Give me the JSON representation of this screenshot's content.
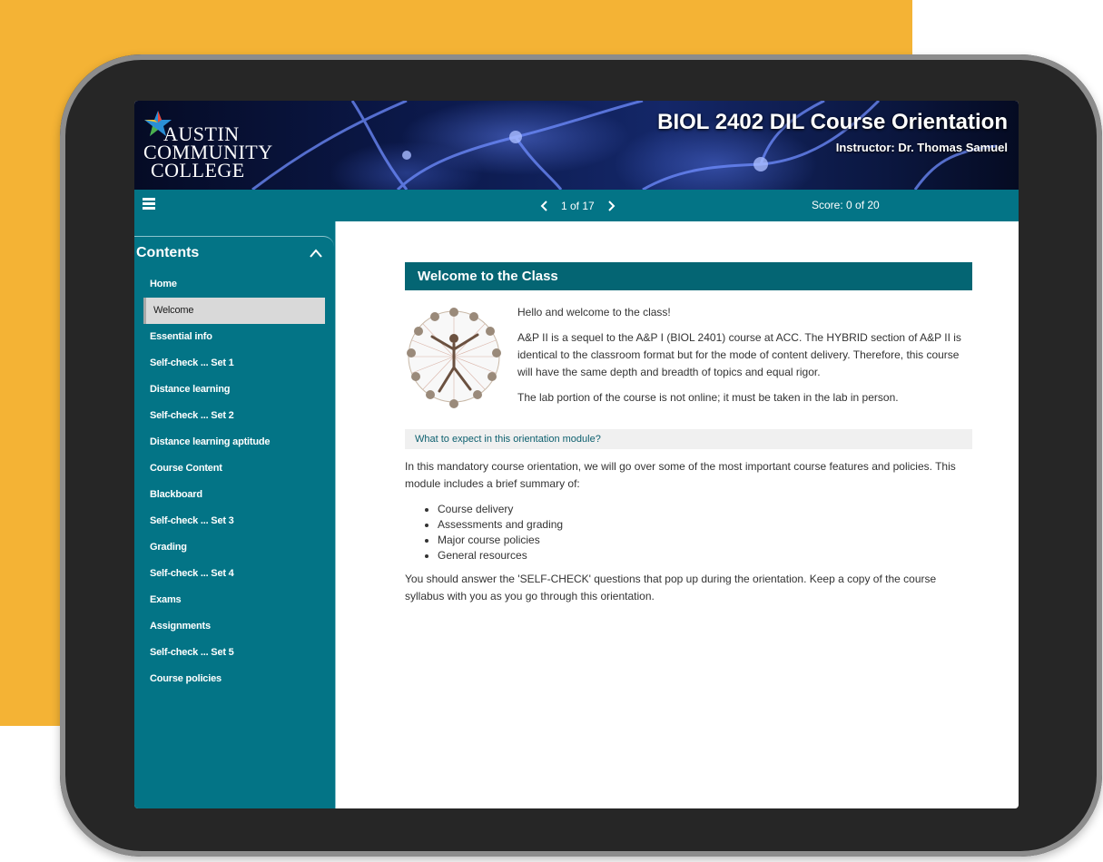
{
  "logo": {
    "line1": "Austin",
    "line2": "Community",
    "line3": "College"
  },
  "header": {
    "title": "BIOL 2402 DIL Course Orientation",
    "instructor": "Instructor: Dr. Thomas Samuel"
  },
  "toolbar": {
    "page_indicator": "1 of 17",
    "score": "Score: 0 of 20"
  },
  "sidebar": {
    "heading": "Contents",
    "items": [
      {
        "label": "Home"
      },
      {
        "label": "Welcome",
        "active": true
      },
      {
        "label": "Essential info"
      },
      {
        "label": "Self-check ... Set 1"
      },
      {
        "label": "Distance learning"
      },
      {
        "label": "Self-check ... Set 2"
      },
      {
        "label": "Distance learning aptitude"
      },
      {
        "label": "Course Content"
      },
      {
        "label": "Blackboard"
      },
      {
        "label": "Self-check ... Set 3"
      },
      {
        "label": "Grading"
      },
      {
        "label": "Self-check ... Set 4"
      },
      {
        "label": "Exams"
      },
      {
        "label": "Assignments"
      },
      {
        "label": "Self-check ... Set 5"
      },
      {
        "label": "Course policies"
      }
    ]
  },
  "main": {
    "section_title": "Welcome to the Class",
    "greeting": "Hello and welcome to the class!",
    "paragraph1": "A&P II is a sequel to the A&P I (BIOL 2401) course at ACC. The HYBRID section of A&P II is identical to the classroom format but for the mode of content delivery. Therefore, this course will have the same depth and breadth of topics and equal rigor.",
    "paragraph2": "The lab portion of the course is not online; it must be taken in the lab in person.",
    "subheading": "What to expect in this orientation module?",
    "paragraph3": "In this mandatory course orientation, we will go over some of the most important course features and policies. This module includes a brief summary of:",
    "bullets": [
      "Course delivery",
      "Assessments and grading",
      "Major course policies",
      "General resources"
    ],
    "paragraph4": "You should answer the 'SELF-CHECK' questions that pop up during the orientation. Keep a copy of the course syllabus with you as you go through this orientation."
  },
  "colors": {
    "background_accent": "#f4b335",
    "toolbar": "#037486",
    "section_header": "#046573",
    "tablet_frame": "#262626"
  }
}
